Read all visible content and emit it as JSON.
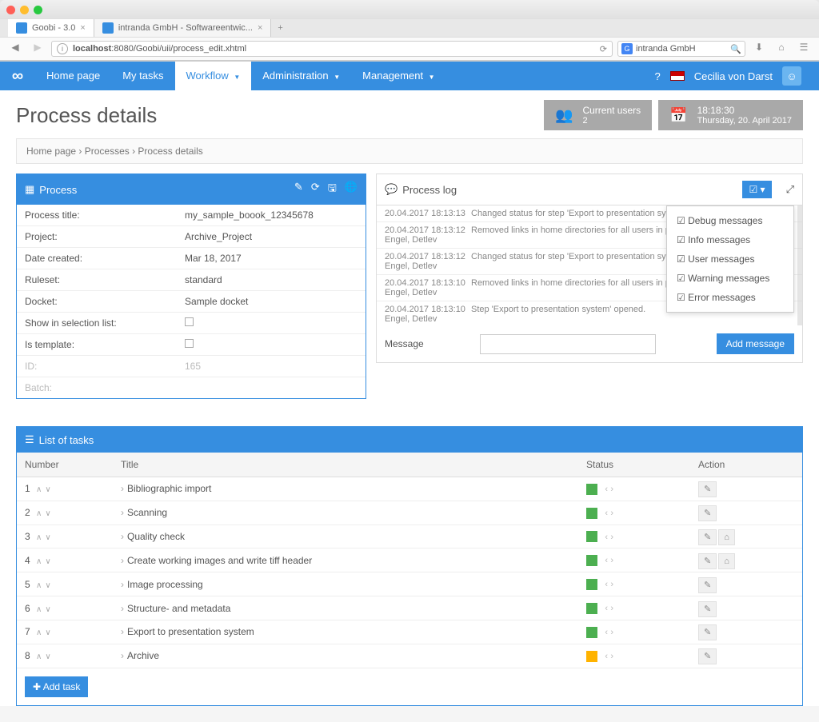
{
  "browser": {
    "tabs": [
      {
        "title": "Goobi - 3.0",
        "active": true
      },
      {
        "title": "intranda GmbH - Softwareentwic...",
        "active": false
      }
    ],
    "url_host": "localhost",
    "url_path": ":8080/Goobi/uii/process_edit.xhtml",
    "search_value": "intranda GmbH"
  },
  "nav": {
    "items": [
      "Home page",
      "My tasks",
      "Workflow",
      "Administration",
      "Management"
    ],
    "active": "Workflow",
    "user": "Cecilia von Darst"
  },
  "header": {
    "title": "Process details",
    "users_label": "Current users",
    "users_count": "2",
    "time": "18:18:30",
    "date": "Thursday, 20. April 2017"
  },
  "crumbs": [
    "Home page",
    "Processes",
    "Process details"
  ],
  "process_panel": {
    "title": "Process",
    "rows": [
      {
        "label": "Process title:",
        "value": "my_sample_boook_12345678"
      },
      {
        "label": "Project:",
        "value": "Archive_Project"
      },
      {
        "label": "Date created:",
        "value": "Mar 18, 2017"
      },
      {
        "label": "Ruleset:",
        "value": "standard"
      },
      {
        "label": "Docket:",
        "value": "Sample docket"
      },
      {
        "label": "Show in selection list:",
        "value": "checkbox"
      },
      {
        "label": "Is template:",
        "value": "checkbox"
      },
      {
        "label": "ID:",
        "value": "165",
        "muted": true
      },
      {
        "label": "Batch:",
        "value": "",
        "muted": true
      }
    ]
  },
  "log_panel": {
    "title": "Process log",
    "entries": [
      {
        "ts": "20.04.2017 18:13:10",
        "who": "Engel, Detlev",
        "text": "Step 'Export to presentation system' opened."
      },
      {
        "ts": "20.04.2017 18:13:10",
        "who": "Engel, Detlev",
        "text": "Removed links in home directories for all users in process details."
      },
      {
        "ts": "20.04.2017 18:13:12",
        "who": "Engel, Detlev",
        "text": "Changed status for step 'Export to presentation system' to 3 in process details."
      },
      {
        "ts": "20.04.2017 18:13:12",
        "who": "Engel, Detlev",
        "text": "Removed links in home directories for all users in process details."
      },
      {
        "ts": "20.04.2017 18:13:13",
        "who": "",
        "text": "Changed status for step 'Export to presentation system' to 3 in process details."
      }
    ],
    "message_label": "Message",
    "add_btn": "Add message",
    "filters": [
      "Debug messages",
      "Info messages",
      "User messages",
      "Warning messages",
      "Error messages"
    ]
  },
  "tasks_panel": {
    "title": "List of tasks",
    "cols": {
      "num": "Number",
      "title": "Title",
      "status": "Status",
      "action": "Action"
    },
    "rows": [
      {
        "n": "1",
        "title": "Bibliographic import",
        "status": "green",
        "actions": [
          "edit"
        ]
      },
      {
        "n": "2",
        "title": "Scanning",
        "status": "green",
        "actions": [
          "edit"
        ]
      },
      {
        "n": "3",
        "title": "Quality check",
        "status": "green",
        "actions": [
          "edit",
          "home"
        ]
      },
      {
        "n": "4",
        "title": "Create working images and write tiff header",
        "status": "green",
        "actions": [
          "edit",
          "home"
        ]
      },
      {
        "n": "5",
        "title": "Image processing",
        "status": "green",
        "actions": [
          "edit"
        ]
      },
      {
        "n": "6",
        "title": "Structure- and metadata",
        "status": "green",
        "actions": [
          "edit"
        ]
      },
      {
        "n": "7",
        "title": "Export to presentation system",
        "status": "green",
        "actions": [
          "edit"
        ]
      },
      {
        "n": "8",
        "title": "Archive",
        "status": "orange",
        "actions": [
          "edit"
        ]
      }
    ],
    "add_btn": "Add task"
  }
}
